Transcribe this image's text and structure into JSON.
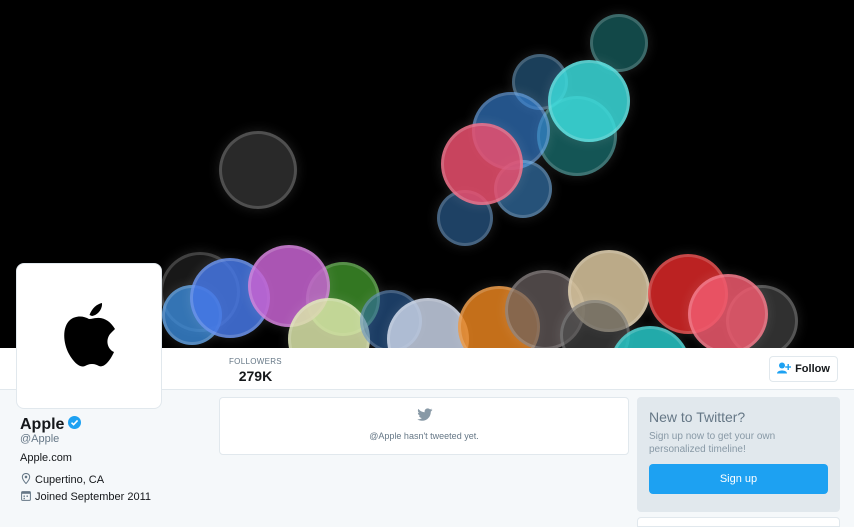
{
  "profile": {
    "name": "Apple",
    "handle": "@Apple",
    "website": "Apple.com",
    "location": "Cupertino, CA",
    "joined": "Joined September 2011"
  },
  "stats": {
    "followers_label": "FOLLOWERS",
    "followers_value": "279K"
  },
  "actions": {
    "follow_label": "Follow"
  },
  "timeline": {
    "empty_text": "@Apple hasn't tweeted yet."
  },
  "signup": {
    "title": "New to Twitter?",
    "subtitle": "Sign up now to get your own personalized timeline!",
    "button_label": "Sign up"
  },
  "colors": {
    "accent": "#1da1f2",
    "background": "#f5f8fa",
    "border": "#e1e8ed",
    "muted": "#657786"
  },
  "icons": {
    "logo": "apple-logo-icon",
    "verified": "verified-badge-icon",
    "location": "location-pin-icon",
    "calendar": "calendar-icon",
    "follow": "add-user-icon",
    "bird": "twitter-bird-icon"
  }
}
